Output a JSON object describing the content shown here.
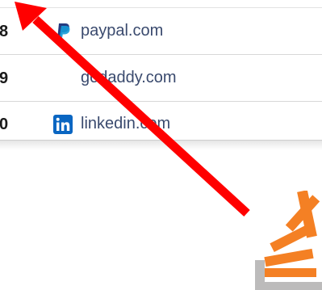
{
  "table": {
    "rows": [
      {
        "rank": "8",
        "site": "paypal.com",
        "icon": "paypal-icon"
      },
      {
        "rank": "9",
        "site": "godaddy.com",
        "icon": ""
      },
      {
        "rank": "0",
        "site": "linkedin.com",
        "icon": "linkedin-icon"
      }
    ]
  },
  "overlay": {
    "arrow_color": "#ff0000",
    "logo": "stackoverflow-logo",
    "logo_colors": {
      "bars": "#f48024",
      "tray": "#bcbbbb"
    }
  }
}
